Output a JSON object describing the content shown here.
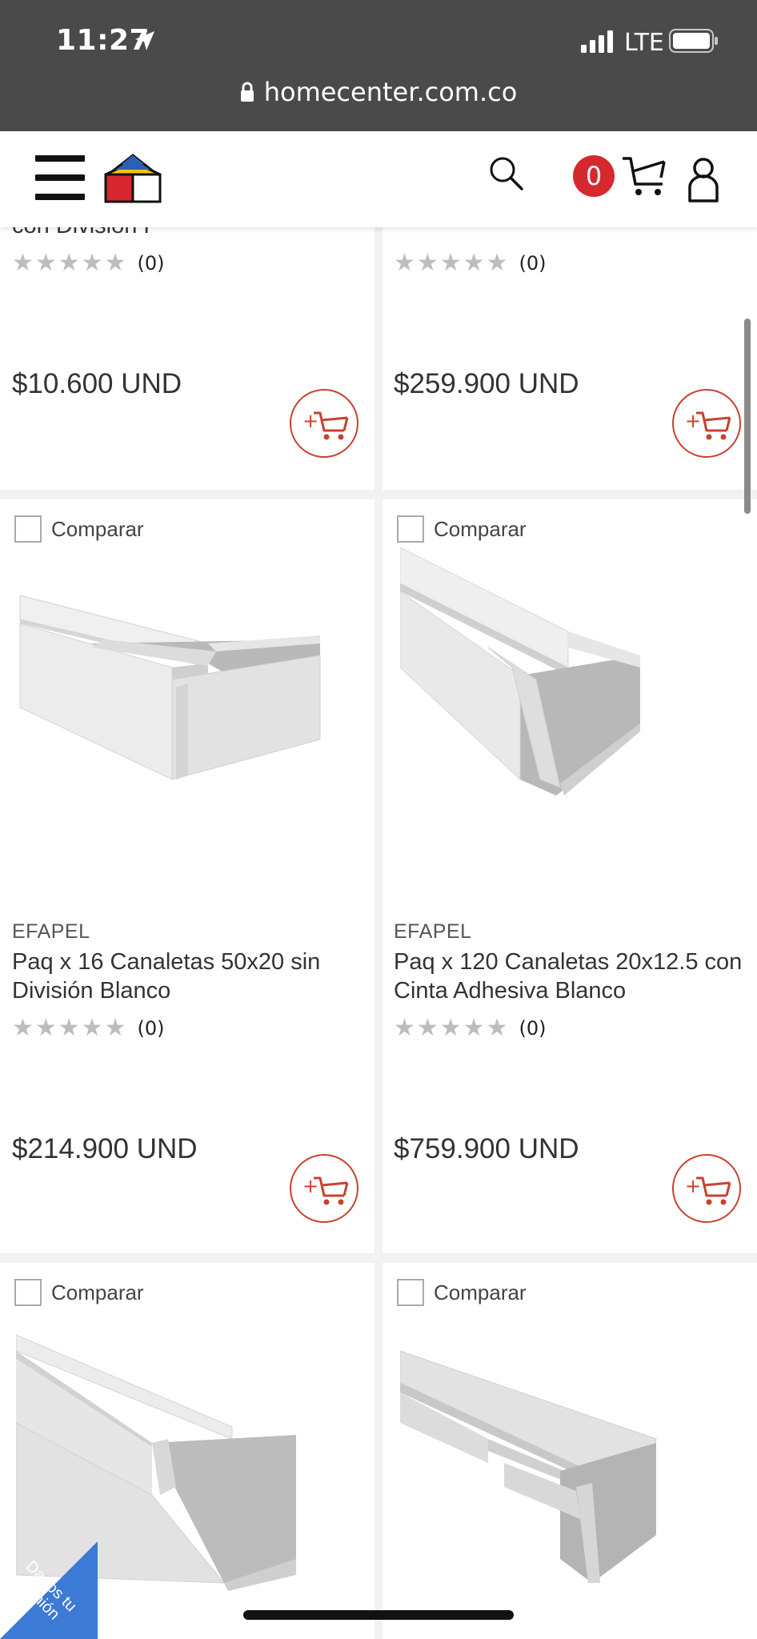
{
  "status_bar": {
    "time": "11:27",
    "network": "LTE",
    "url": "homecenter.com.co"
  },
  "header": {
    "cart_count": "0"
  },
  "products": [
    {
      "partial_name": "con División P",
      "rating_count": "(0)",
      "price": "$10.600 UND"
    },
    {
      "rating_count": "(0)",
      "price": "$259.900 UND"
    },
    {
      "compare_label": "Comparar",
      "brand": "EFAPEL",
      "name": "Paq x 16 Canaletas 50x20 sin División Blanco",
      "rating_count": "(0)",
      "price": "$214.900 UND"
    },
    {
      "compare_label": "Comparar",
      "brand": "EFAPEL",
      "name": "Paq x 120 Canaletas 20x12.5 con Cinta Adhesiva Blanco",
      "rating_count": "(0)",
      "price": "$759.900 UND"
    },
    {
      "compare_label": "Comparar"
    },
    {
      "compare_label": "Comparar"
    }
  ],
  "feedback": {
    "label": "Danos tu opinión"
  },
  "colors": {
    "brand_red": "#d7282f",
    "add_cart_red": "#c9412f",
    "feedback_blue": "#3c7ad6",
    "status_bg": "#4a4a4a"
  }
}
